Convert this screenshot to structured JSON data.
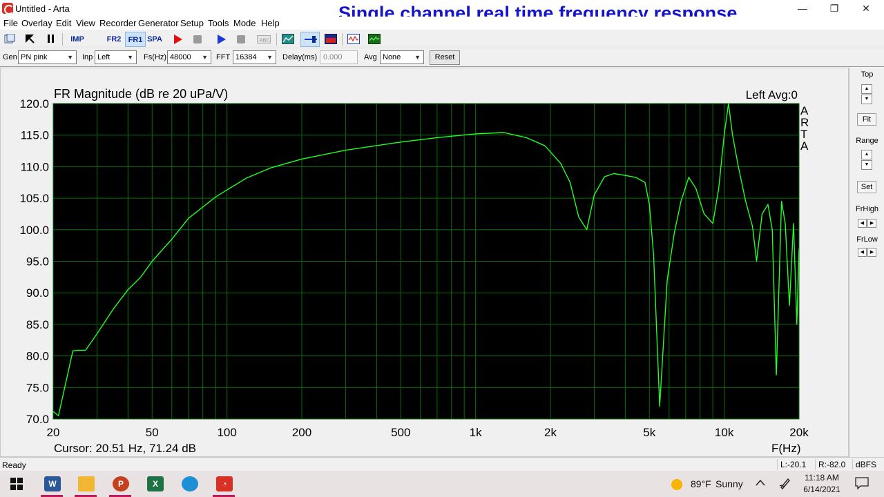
{
  "window": {
    "title": "Untitled - Arta",
    "overlay_title": "Single channel real time frequency response",
    "minimize": "—",
    "maximize": "❐",
    "close": "✕"
  },
  "menu": [
    "File",
    "Overlay",
    "Edit",
    "View",
    "Recorder",
    "Generator",
    "Setup",
    "Tools",
    "Mode",
    "Help"
  ],
  "toolbar": {
    "imp": "IMP",
    "fr2": "FR2",
    "fr1": "FR1",
    "spa": "SPA"
  },
  "controls": {
    "gen_label": "Gen",
    "gen_value": "PN pink",
    "inp_label": "Inp",
    "inp_value": "Left",
    "fs_label": "Fs(Hz)",
    "fs_value": "48000",
    "fft_label": "FFT",
    "fft_value": "16384",
    "delay_label": "Delay(ms)",
    "delay_value": "0.000",
    "avg_label": "Avg",
    "avg_value": "None",
    "reset_label": "Reset"
  },
  "right_panel": {
    "top": "Top",
    "fit": "Fit",
    "range": "Range",
    "set": "Set",
    "frhigh": "FrHigh",
    "frlow": "FrLow"
  },
  "plot": {
    "ylabel": "FR Magnitude (dB re 20 uPa/V)",
    "channel_info": "Left  Avg:0",
    "watermark": [
      "A",
      "R",
      "T",
      "A"
    ],
    "xlabel": "F(Hz)",
    "cursor": "Cursor: 20.51 Hz, 71.24 dB",
    "bg_color": "#000000",
    "grid_color": "#0a6e0a",
    "trace_color": "#22ff22"
  },
  "chart_data": {
    "type": "line",
    "title": "FR Magnitude (dB re 20 uPa/V)",
    "xlabel": "F(Hz)",
    "ylabel": "",
    "xscale": "log",
    "xlim": [
      20,
      20000
    ],
    "ylim": [
      70,
      120
    ],
    "x_ticks": [
      "20",
      "50",
      "100",
      "200",
      "500",
      "1k",
      "2k",
      "5k",
      "10k",
      "20k"
    ],
    "y_ticks": [
      "120.0",
      "115.0",
      "110.0",
      "105.0",
      "100.0",
      "95.0",
      "90.0",
      "85.0",
      "80.0",
      "75.0",
      "70.0"
    ],
    "grid": true,
    "series": [
      {
        "x": [
          20,
          21,
          24,
          25,
          27,
          30,
          35,
          40,
          45,
          50,
          60,
          70,
          80,
          90,
          100,
          120,
          150,
          200,
          300,
          500,
          700,
          1000,
          1300,
          1600,
          1900,
          2200,
          2400,
          2600,
          2800,
          3000,
          3300,
          3600,
          4000,
          4400,
          4800,
          5000,
          5200,
          5500,
          5900,
          6300,
          6700,
          7200,
          7700,
          8300,
          9000,
          9500,
          10000,
          10400,
          10800,
          11400,
          12200,
          13000,
          13500,
          14200,
          15000,
          15600,
          16200,
          17000,
          17600,
          18300,
          19000,
          19600,
          20000
        ],
        "y": [
          71.2,
          70.5,
          80.8,
          80.9,
          80.9,
          83.5,
          87.5,
          90.5,
          92.5,
          95.0,
          98.5,
          101.8,
          103.6,
          105.2,
          106.3,
          108.2,
          109.8,
          111.2,
          112.6,
          113.9,
          114.6,
          115.2,
          115.4,
          114.6,
          113.3,
          110.5,
          107.5,
          102.0,
          100.0,
          105.5,
          108.4,
          108.9,
          108.6,
          108.3,
          107.5,
          104.0,
          96.0,
          72.0,
          92.0,
          99.5,
          104.5,
          108.3,
          106.5,
          102.5,
          101.0,
          106.5,
          115.0,
          120.0,
          115.0,
          110.0,
          104.5,
          100.5,
          95.0,
          102.5,
          104.0,
          100.0,
          77.0,
          104.5,
          101.0,
          88.0,
          101.0,
          85.0,
          97.0
        ]
      }
    ]
  },
  "status": {
    "ready": "Ready",
    "left": "L:-20.1",
    "right": "R:-82.0",
    "unit": "dBFS"
  },
  "taskbar": {
    "weather_temp": "89°F",
    "weather_cond": "Sunny",
    "time": "11:18 AM",
    "date": "6/14/2021"
  }
}
